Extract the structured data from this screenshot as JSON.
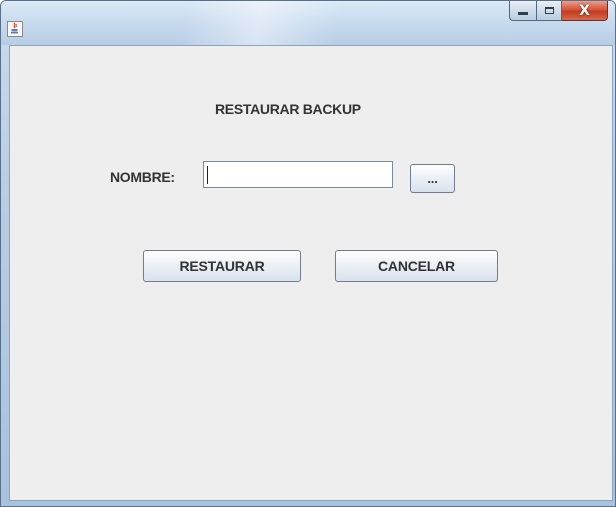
{
  "window": {
    "title": "",
    "app_icon": "java-coffee-icon",
    "controls": {
      "minimize": "minimize-icon",
      "maximize": "maximize-icon",
      "close_label": "X"
    }
  },
  "dialog": {
    "heading": "RESTAURAR BACKUP",
    "name_label": "NOMBRE:",
    "name_value": "",
    "browse_label": "...",
    "restore_label": "RESTAURAR",
    "cancel_label": "CANCELAR"
  }
}
